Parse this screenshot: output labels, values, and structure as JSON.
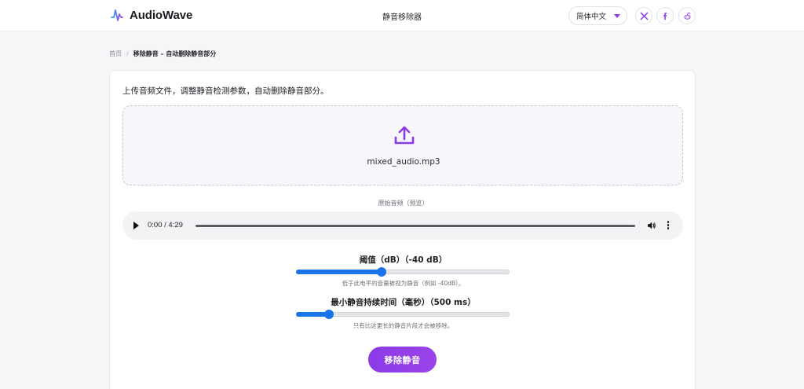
{
  "header": {
    "brand": "AudioWave",
    "title": "静音移除器",
    "language": "简体中文",
    "social": [
      {
        "icon": "x-icon"
      },
      {
        "icon": "facebook-icon"
      },
      {
        "icon": "reddit-icon"
      }
    ]
  },
  "breadcrumb": {
    "home": "首页",
    "separator": "/",
    "current": "移除静音 – 自动删除静音部分"
  },
  "main": {
    "intro": "上传音频文件，调整静音检测参数，自动删除静音部分。",
    "file_name": "mixed_audio.mp3",
    "preview_label": "原始音频（预览）",
    "player": {
      "time": "0:00 / 4:29",
      "progress": 0
    },
    "threshold": {
      "label": "阈值（dB）（-40 dB）",
      "value": -40,
      "fraction": 0.4,
      "hint": "低于此电平的音量被视为静音（例如 -40dB）。"
    },
    "min_duration": {
      "label": "最小静音持续时间（毫秒）（500 ms）",
      "value": 500,
      "fraction": 0.15,
      "hint": "只有比这更长的静音片段才会被移除。"
    },
    "submit_label": "移除静音"
  },
  "colors": {
    "accent": "#8a3be6",
    "slider": "#1a73e8"
  }
}
